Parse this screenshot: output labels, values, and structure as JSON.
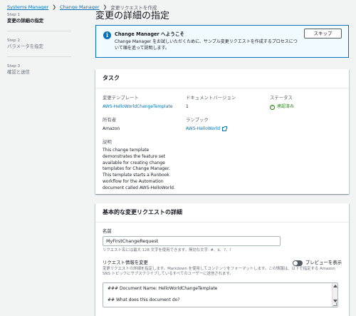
{
  "breadcrumb": {
    "items": [
      "Systems Manager",
      "Change Manager",
      "変更リクエストを作成"
    ]
  },
  "steps": [
    {
      "num": "Step 1",
      "label": "変更の詳細の指定"
    },
    {
      "num": "Step 2",
      "label": "パラメータを指定"
    },
    {
      "num": "Step 3",
      "label": "確認と送信"
    }
  ],
  "page_title": "変更の詳細の指定",
  "info": {
    "title": "Change Manager へようこそ",
    "desc": "Change Manager をお試しいただくために、サンプル変更リクエストを作成するプロセスについて順を追って説明します。",
    "skip_label": "スキップ"
  },
  "task": {
    "header": "タスク",
    "template_label": "変更テンプレート",
    "template_value": "AWS-HelloWorldChangeTemplate",
    "owner_label": "所有者",
    "owner_value": "Amazon",
    "description_label": "説明",
    "description_value": "This change template demonstrates the feature set available for creating change templates for Change Manager. This template starts a Runbook workflow for the Automation document called AWS-HelloWorld.",
    "doc_version_label": "ドキュメントバージョン",
    "doc_version_value": "1",
    "runbook_label": "ランブック",
    "runbook_value": "AWS-HelloWorld",
    "status_label": "ステータス",
    "status_value": "承認済み"
  },
  "basic": {
    "header": "基本的な変更リクエストの詳細",
    "name_label": "名前",
    "name_value": "MyFirstChangeRequest",
    "name_hint": "リクエスト名には最大 128 文字を使用できます。無効な文字: #、$、?、!",
    "info_label": "リクエスト情報を変更",
    "info_hint": "変更リクエストの詳細を指定します。Markdown を使用してコンテンツをフォーマットします。この情報は、以下で指定する Amazon SNS トピックにサブスクライブしているすべてのユーザーに送信されます。",
    "preview_label": "プレビューを表示",
    "textarea_lines": [
      "### Document Name: HelloWorldChangeTemplate",
      "",
      "## What does this document do?"
    ]
  },
  "colors": {
    "link": "#0073bb",
    "success": "#1d8102",
    "info_bg": "#f1faff"
  }
}
